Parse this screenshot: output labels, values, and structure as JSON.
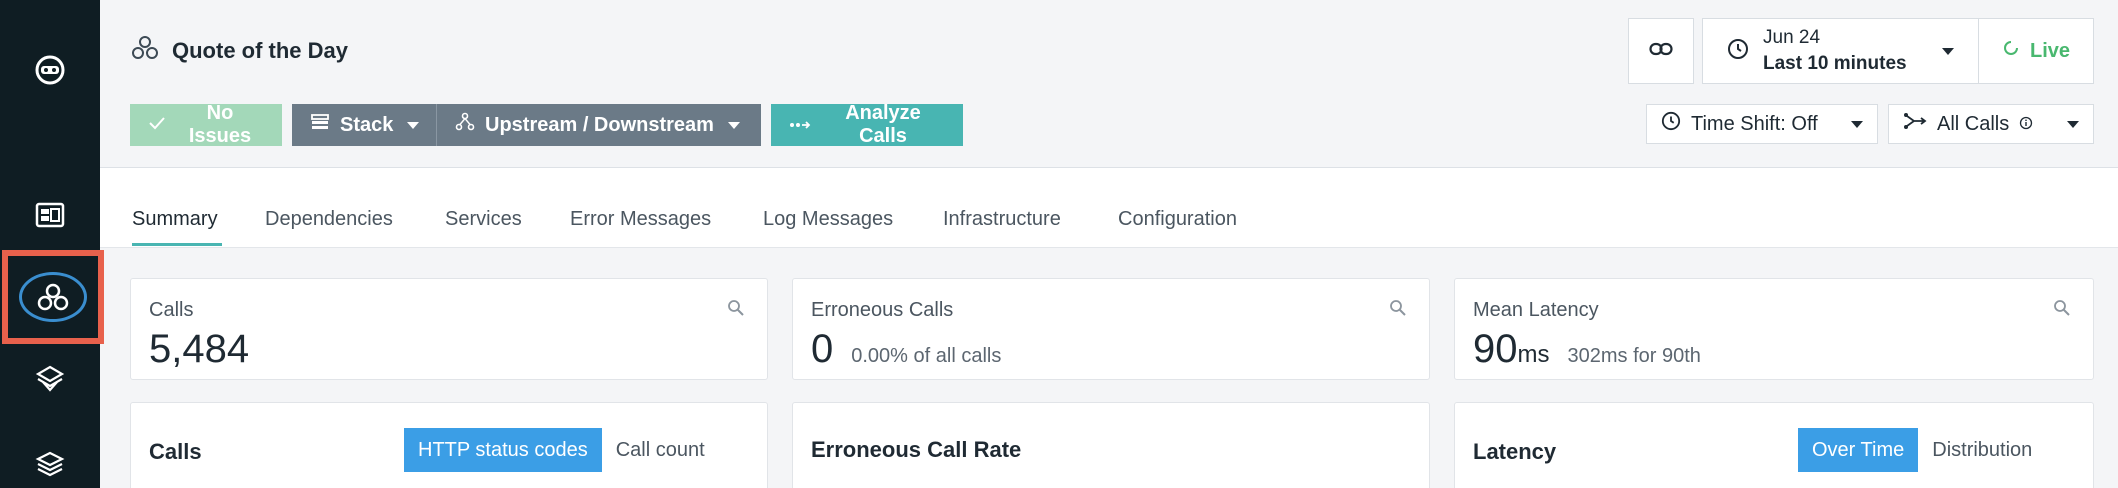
{
  "app": {
    "title": "Quote of the Day"
  },
  "sidebar": {
    "items": [
      {
        "name": "logo"
      },
      {
        "name": "dashboards"
      },
      {
        "name": "applications",
        "selected": true
      },
      {
        "name": "infrastructure"
      },
      {
        "name": "platforms"
      }
    ]
  },
  "header": {
    "issues_label": "No Issues",
    "stack_label": "Stack",
    "updown_label": "Upstream / Downstream",
    "analyze_label": "Analyze Calls",
    "time_date": "Jun 24",
    "time_range": "Last 10 minutes",
    "live_label": "Live",
    "timeshift_label": "Time Shift: Off",
    "calls_filter_label": "All Calls"
  },
  "tabs": [
    {
      "label": "Summary",
      "active": true
    },
    {
      "label": "Dependencies"
    },
    {
      "label": "Services"
    },
    {
      "label": "Error Messages"
    },
    {
      "label": "Log Messages"
    },
    {
      "label": "Infrastructure"
    },
    {
      "label": "Configuration"
    }
  ],
  "metrics": {
    "calls": {
      "label": "Calls",
      "value": "5,484"
    },
    "errors": {
      "label": "Erroneous Calls",
      "value": "0",
      "sub": "0.00% of all calls"
    },
    "latency": {
      "label": "Mean Latency",
      "value": "90",
      "unit": "ms",
      "sub": "302ms for 90th"
    }
  },
  "charts": {
    "calls": {
      "title": "Calls",
      "seg_on": "HTTP status codes",
      "seg_off": "Call count"
    },
    "error_rate": {
      "title": "Erroneous Call Rate"
    },
    "latency": {
      "title": "Latency",
      "seg_on": "Over Time",
      "seg_off": "Distribution"
    }
  },
  "colors": {
    "sidebar_bg": "#0f1d23",
    "highlight": "#e8614c",
    "accent": "#48b5b2",
    "live": "#49b86f",
    "primary": "#3b9ee6"
  }
}
